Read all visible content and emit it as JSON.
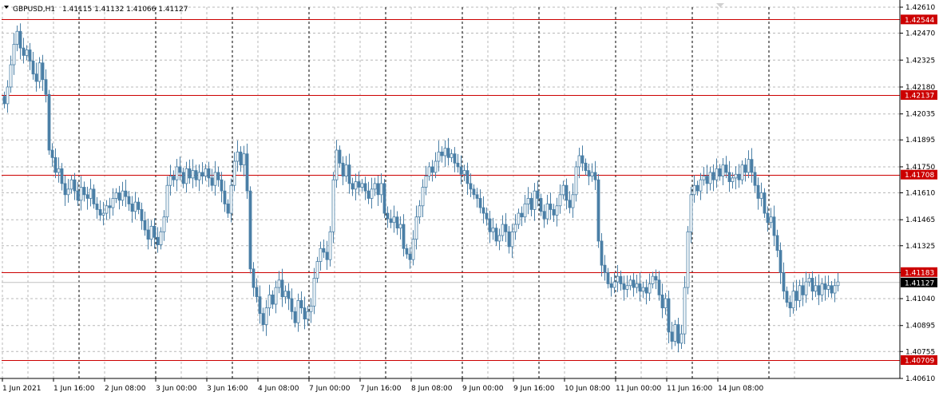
{
  "header": {
    "symbol": "GBPUSD,H1",
    "ohlc": "1.41115 1.41132 1.41066 1.41127"
  },
  "colors": {
    "candle": "#4a7fa6",
    "level_line": "#cc0000",
    "level_label_bg": "#cc0000",
    "price_label_bg": "#000000",
    "grid": "#b8b8b8",
    "day_separator": "#000000",
    "current_line": "#c0c0c0"
  },
  "chart_data": {
    "type": "candlestick",
    "symbol": "GBPUSD",
    "timeframe": "H1",
    "ylim": [
      1.4061,
      1.4261
    ],
    "y_ticks": [
      "1.42610",
      "1.42470",
      "1.42325",
      "1.42180",
      "1.42035",
      "1.41895",
      "1.41750",
      "1.41610",
      "1.41465",
      "1.41325",
      "1.41180",
      "1.41040",
      "1.40895",
      "1.40755",
      "1.40610"
    ],
    "x_ticks": [
      "1 Jun 2021",
      "1 Jun 16:00",
      "2 Jun 08:00",
      "3 Jun 00:00",
      "3 Jun 16:00",
      "4 Jun 08:00",
      "7 Jun 00:00",
      "7 Jun 16:00",
      "8 Jun 08:00",
      "9 Jun 00:00",
      "9 Jun 16:00",
      "10 Jun 08:00",
      "11 Jun 00:00",
      "11 Jun 16:00",
      "14 Jun 08:00"
    ],
    "horizontal_levels": [
      "1.42544",
      "1.42137",
      "1.41708",
      "1.41183",
      "1.40709"
    ],
    "current_price": "1.41127",
    "grid": true,
    "closes": [
      1.4209,
      1.4218,
      1.423,
      1.4241,
      1.4248,
      1.4239,
      1.4235,
      1.4238,
      1.4232,
      1.4225,
      1.4221,
      1.4231,
      1.4222,
      1.4214,
      1.4184,
      1.418,
      1.4172,
      1.4174,
      1.4166,
      1.416,
      1.4163,
      1.4168,
      1.4162,
      1.4157,
      1.4164,
      1.416,
      1.4158,
      1.4163,
      1.4155,
      1.4152,
      1.4149,
      1.415,
      1.4154,
      1.4153,
      1.4158,
      1.4161,
      1.4157,
      1.4162,
      1.4159,
      1.4155,
      1.4151,
      1.4156,
      1.4152,
      1.4146,
      1.4141,
      1.4136,
      1.4143,
      1.4137,
      1.4133,
      1.414,
      1.4148,
      1.4165,
      1.417,
      1.4168,
      1.4175,
      1.4172,
      1.4166,
      1.4174,
      1.4169,
      1.4173,
      1.4168,
      1.4172,
      1.417,
      1.4174,
      1.4169,
      1.4165,
      1.4172,
      1.4168,
      1.4162,
      1.4155,
      1.415,
      1.4165,
      1.4178,
      1.4183,
      1.4176,
      1.4182,
      1.4162,
      1.412,
      1.411,
      1.4105,
      1.4096,
      1.409,
      1.4099,
      1.4106,
      1.4101,
      1.411,
      1.4114,
      1.4105,
      1.4108,
      1.4104,
      1.4097,
      1.4091,
      1.4103,
      1.4099,
      1.4093,
      1.4097,
      1.41,
      1.4115,
      1.4124,
      1.4131,
      1.4129,
      1.4125,
      1.414,
      1.4168,
      1.4184,
      1.4177,
      1.417,
      1.4176,
      1.4166,
      1.4163,
      1.4167,
      1.4164,
      1.4166,
      1.4162,
      1.4158,
      1.4163,
      1.4166,
      1.416,
      1.4166,
      1.415,
      1.4147,
      1.4145,
      1.4148,
      1.4142,
      1.4144,
      1.4131,
      1.4128,
      1.4125,
      1.4136,
      1.4148,
      1.4154,
      1.4164,
      1.417,
      1.4175,
      1.4172,
      1.4178,
      1.4183,
      1.4181,
      1.4185,
      1.418,
      1.4182,
      1.4177,
      1.4175,
      1.4171,
      1.4173,
      1.4166,
      1.4163,
      1.416,
      1.4158,
      1.4153,
      1.415,
      1.4147,
      1.414,
      1.4142,
      1.4135,
      1.4138,
      1.4144,
      1.414,
      1.4132,
      1.414,
      1.4144,
      1.415,
      1.4148,
      1.4155,
      1.4158,
      1.4152,
      1.4162,
      1.4158,
      1.4151,
      1.4147,
      1.4155,
      1.4152,
      1.4149,
      1.4154,
      1.416,
      1.4165,
      1.4157,
      1.4153,
      1.416,
      1.4175,
      1.4181,
      1.4177,
      1.4173,
      1.417,
      1.4172,
      1.4168,
      1.4135,
      1.4122,
      1.4118,
      1.4112,
      1.411,
      1.4113,
      1.4116,
      1.4112,
      1.4109,
      1.4111,
      1.4114,
      1.411,
      1.4112,
      1.4108,
      1.411,
      1.4107,
      1.4112,
      1.4116,
      1.4114,
      1.4106,
      1.4099,
      1.4104,
      1.4086,
      1.4081,
      1.409,
      1.408,
      1.4085,
      1.411,
      1.414,
      1.416,
      1.4165,
      1.4162,
      1.4168,
      1.417,
      1.4166,
      1.4172,
      1.4168,
      1.4174,
      1.417,
      1.4176,
      1.4172,
      1.4167,
      1.4169,
      1.4171,
      1.4168,
      1.4176,
      1.4172,
      1.4179,
      1.4172,
      1.4165,
      1.4158,
      1.4161,
      1.415,
      1.4145,
      1.4148,
      1.4138,
      1.413,
      1.4118,
      1.4108,
      1.4102,
      1.4099,
      1.4108,
      1.4103,
      1.4111,
      1.4106,
      1.4113,
      1.4115,
      1.4108,
      1.4111,
      1.4106,
      1.4112,
      1.4109,
      1.4111,
      1.4107,
      1.4111,
      1.4113
    ]
  }
}
